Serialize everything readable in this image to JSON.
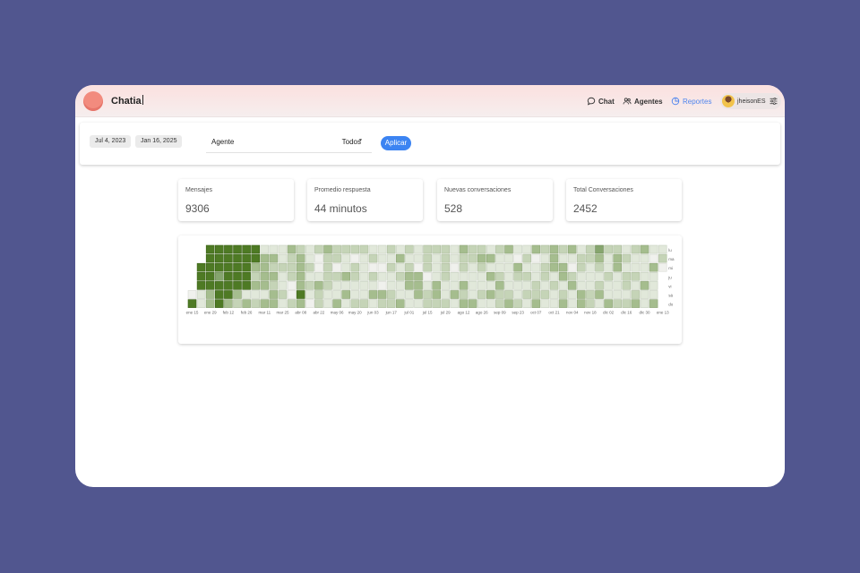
{
  "app": {
    "title": "Chatia"
  },
  "nav": {
    "items": [
      {
        "label": "Chat",
        "icon": "chat-bubble-icon",
        "active": false
      },
      {
        "label": "Agentes",
        "icon": "users-icon",
        "active": false
      },
      {
        "label": "Reportes",
        "icon": "pie-chart-icon",
        "active": true
      }
    ],
    "user": {
      "name": "jheisonES",
      "avatar": "avatar-emoji",
      "menu_icon": "sliders-icon"
    }
  },
  "filters": {
    "start_date": "Jul 4, 2023",
    "end_date": "Jan 16, 2025",
    "agent_label": "Agente",
    "agent_value": "Todos",
    "apply_label": "Aplicar"
  },
  "stats": [
    {
      "label": "Mensajes",
      "value": "9306"
    },
    {
      "label": "Promedio respuesta",
      "value": "44 minutos"
    },
    {
      "label": "Nuevas conversaciones",
      "value": "528"
    },
    {
      "label": "Total Conversaciones",
      "value": "2452"
    }
  ],
  "colors": {
    "background": "#51568f",
    "accent": "#3c84f2",
    "heat_levels": [
      "#f0f1ed",
      "#e1e8da",
      "#c5d4b7",
      "#a5bd8e",
      "#86a56e",
      "#4e7a24"
    ]
  },
  "chart_data": {
    "type": "heatmap",
    "x_tick_labels": [
      "ene 15",
      "ene 29",
      "feb 12",
      "feb 26",
      "mar 11",
      "mar 25",
      "abr 08",
      "abr 22",
      "may 06",
      "may 20",
      "jun 03",
      "jun 17",
      "jul 01",
      "jul 15",
      "jul 29",
      "ago 12",
      "ago 26",
      "sep 09",
      "sep 23",
      "oct 07",
      "oct 21",
      "nov 04",
      "nov 18",
      "dic 02",
      "dic 16",
      "dic 30",
      "ene 13"
    ],
    "y_tick_labels": [
      "lu",
      "ma",
      "mi",
      "ju",
      "vi",
      "sá",
      "do"
    ],
    "weeks": 53,
    "levels": [
      [
        null,
        null,
        null,
        null,
        null,
        0,
        5
      ],
      [
        null,
        null,
        5,
        5,
        5,
        1,
        1
      ],
      [
        5,
        5,
        5,
        5,
        5,
        3,
        3
      ],
      [
        5,
        5,
        5,
        4,
        5,
        5,
        5
      ],
      [
        5,
        5,
        5,
        5,
        5,
        5,
        3
      ],
      [
        5,
        5,
        5,
        5,
        5,
        3,
        2
      ],
      [
        5,
        5,
        5,
        5,
        5,
        1,
        3
      ],
      [
        5,
        5,
        3,
        2,
        3,
        1,
        2
      ],
      [
        1,
        3,
        3,
        3,
        3,
        1,
        3
      ],
      [
        1,
        3,
        2,
        3,
        2,
        3,
        3
      ],
      [
        1,
        1,
        2,
        1,
        1,
        2,
        1
      ],
      [
        3,
        2,
        2,
        2,
        0,
        0,
        2
      ],
      [
        2,
        3,
        3,
        3,
        3,
        5,
        3
      ],
      [
        1,
        1,
        2,
        1,
        2,
        1,
        0
      ],
      [
        2,
        0,
        0,
        1,
        3,
        2,
        2
      ],
      [
        3,
        2,
        2,
        2,
        2,
        1,
        1
      ],
      [
        2,
        2,
        0,
        2,
        1,
        1,
        3
      ],
      [
        2,
        1,
        1,
        3,
        1,
        3,
        1
      ],
      [
        2,
        0,
        2,
        2,
        1,
        1,
        2
      ],
      [
        2,
        1,
        1,
        1,
        1,
        1,
        2
      ],
      [
        1,
        2,
        0,
        2,
        1,
        3,
        1
      ],
      [
        1,
        1,
        0,
        1,
        0,
        3,
        2
      ],
      [
        2,
        1,
        2,
        1,
        1,
        2,
        2
      ],
      [
        1,
        3,
        1,
        2,
        1,
        1,
        3
      ],
      [
        2,
        1,
        2,
        3,
        3,
        1,
        1
      ],
      [
        1,
        1,
        0,
        3,
        3,
        3,
        1
      ],
      [
        2,
        2,
        2,
        0,
        1,
        2,
        2
      ],
      [
        2,
        1,
        1,
        1,
        3,
        3,
        2
      ],
      [
        2,
        2,
        2,
        2,
        1,
        1,
        2
      ],
      [
        1,
        1,
        0,
        1,
        1,
        3,
        1
      ],
      [
        3,
        2,
        2,
        1,
        3,
        2,
        3
      ],
      [
        2,
        2,
        1,
        1,
        1,
        1,
        3
      ],
      [
        2,
        3,
        2,
        1,
        1,
        2,
        1
      ],
      [
        1,
        3,
        1,
        3,
        1,
        3,
        1
      ],
      [
        2,
        1,
        1,
        2,
        3,
        2,
        2
      ],
      [
        3,
        1,
        1,
        1,
        1,
        2,
        3
      ],
      [
        1,
        0,
        3,
        2,
        1,
        1,
        2
      ],
      [
        1,
        2,
        1,
        2,
        1,
        2,
        1
      ],
      [
        3,
        0,
        1,
        1,
        2,
        2,
        3
      ],
      [
        2,
        1,
        2,
        2,
        1,
        2,
        1
      ],
      [
        3,
        3,
        3,
        1,
        2,
        1,
        1
      ],
      [
        2,
        1,
        3,
        3,
        1,
        2,
        3
      ],
      [
        3,
        1,
        0,
        2,
        3,
        1,
        1
      ],
      [
        1,
        2,
        2,
        1,
        1,
        3,
        3
      ],
      [
        2,
        2,
        1,
        1,
        1,
        2,
        2
      ],
      [
        4,
        3,
        2,
        1,
        2,
        3,
        1
      ],
      [
        2,
        1,
        1,
        2,
        1,
        1,
        3
      ],
      [
        2,
        3,
        3,
        1,
        1,
        1,
        2
      ],
      [
        1,
        2,
        1,
        2,
        2,
        1,
        2
      ],
      [
        2,
        1,
        1,
        2,
        1,
        2,
        3
      ],
      [
        3,
        1,
        1,
        1,
        3,
        1,
        1
      ],
      [
        1,
        0,
        3,
        1,
        1,
        1,
        3
      ],
      [
        1,
        2,
        0,
        null,
        null,
        null,
        null
      ]
    ]
  }
}
